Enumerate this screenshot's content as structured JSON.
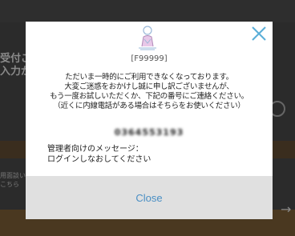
{
  "background": {
    "line1": "受付ご",
    "line2": "入力が",
    "small1": "用面談い",
    "small2": "こちら"
  },
  "modal": {
    "close_icon": "close-icon",
    "illustration_icon": "person-bowing-icon",
    "error_code": "[F99999]",
    "message_lines": [
      "ただいま一時的にご利用できなくなっております。",
      "大変ご迷惑をおかけし誠に申し訳ございませんが、",
      "もう一度お試しいただくか、下記の番号にご連絡ください。",
      "（近くに内線電話がある場合はそちらをお使いください）"
    ],
    "phone_number": "0364553193",
    "admin_label": "管理者向けのメッセージ：",
    "admin_message": "ログインしなおしてください",
    "close_label": "Close"
  },
  "colors": {
    "accent": "#4a8fc4",
    "icon": "#5aaed8",
    "footer": "#e0e0e0"
  }
}
